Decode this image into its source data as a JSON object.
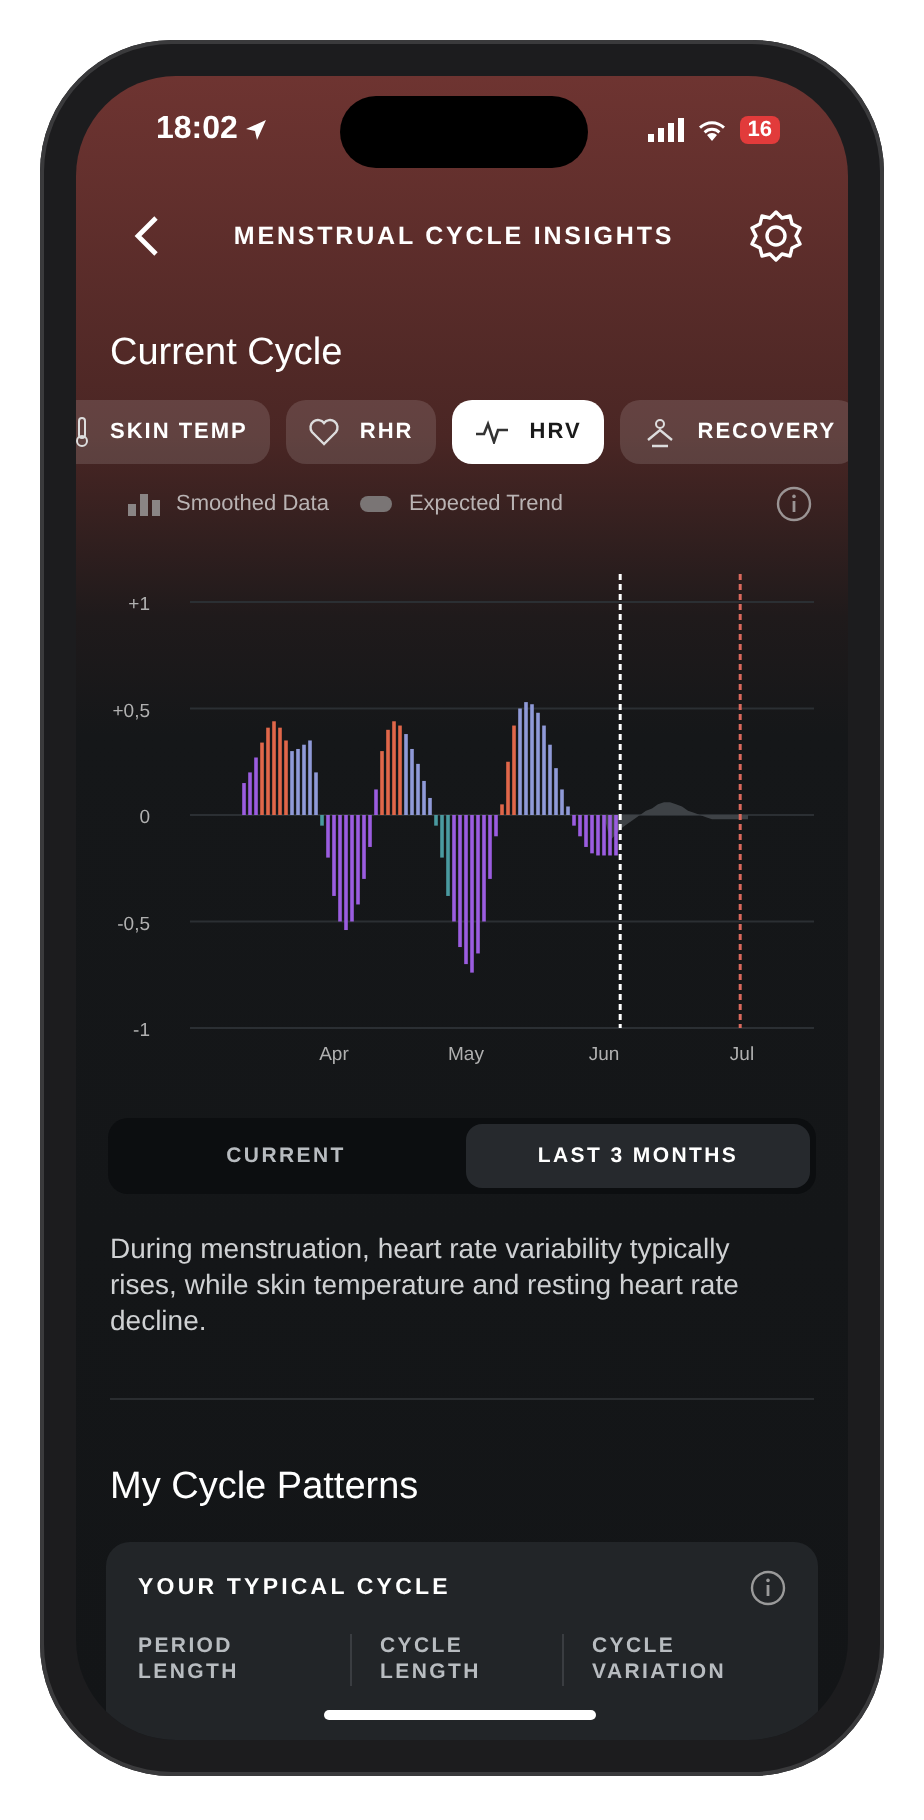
{
  "status_bar": {
    "time": "18:02",
    "battery": "16"
  },
  "header": {
    "title": "MENSTRUAL CYCLE INSIGHTS"
  },
  "current_cycle": {
    "title": "Current Cycle",
    "metric_tabs": [
      {
        "kind": "thermometer",
        "label": "SKIN TEMP",
        "selected": false
      },
      {
        "kind": "heart",
        "label": "RHR",
        "selected": false
      },
      {
        "kind": "pulse",
        "label": "HRV",
        "selected": true
      },
      {
        "kind": "recovery",
        "label": "RECOVERY",
        "selected": false
      }
    ],
    "legend": [
      {
        "kind": "bars",
        "label": "Smoothed Data"
      },
      {
        "kind": "pill",
        "label": "Expected Trend"
      }
    ],
    "chart_data": {
      "type": "bar",
      "grid": true,
      "categories": [
        null,
        null,
        null,
        null,
        null,
        null,
        null,
        null,
        null,
        null,
        null,
        null,
        null,
        null,
        null,
        "Apr",
        null,
        null,
        null,
        null,
        null,
        null,
        null,
        null,
        null,
        null,
        null,
        null,
        null,
        null,
        null,
        null,
        null,
        null,
        null,
        null,
        null,
        "May",
        null,
        null,
        null,
        null,
        null,
        null,
        null,
        null,
        null,
        null,
        null,
        null,
        null,
        null,
        null,
        null,
        null,
        null,
        null,
        null,
        null,
        null,
        "Jun",
        null,
        null,
        null,
        null,
        null,
        null,
        null,
        null,
        null,
        null,
        null,
        null,
        null,
        null,
        null,
        null,
        null,
        null,
        null,
        null,
        null,
        null,
        "Jul",
        null,
        null,
        null
      ],
      "series": [
        {
          "color": "#9b5de0",
          "values": [
            0.15,
            0.2,
            0.27,
            null,
            null,
            null,
            null,
            null,
            null,
            null,
            null,
            null,
            null,
            null,
            -0.2,
            -0.38,
            -0.5,
            -0.54,
            -0.5,
            -0.42,
            -0.3,
            -0.15,
            0.12,
            null,
            null,
            null,
            null,
            null,
            null,
            null,
            null,
            null,
            null,
            null,
            null,
            -0.5,
            -0.62,
            -0.7,
            -0.74,
            -0.65,
            -0.5,
            -0.3,
            -0.1,
            null,
            null,
            null,
            null,
            null,
            null,
            null,
            null,
            null,
            null,
            null,
            null,
            -0.05,
            -0.1,
            -0.15,
            -0.18,
            -0.19,
            -0.19,
            -0.19,
            -0.19,
            null,
            null,
            null,
            null,
            null,
            null,
            null,
            null,
            null,
            null,
            null,
            null,
            null,
            null,
            null,
            null,
            null,
            null,
            null,
            null,
            null,
            null,
            null,
            null
          ]
        },
        {
          "color": "#e0674a",
          "values": [
            null,
            null,
            null,
            0.34,
            0.41,
            0.44,
            0.41,
            0.35,
            null,
            null,
            null,
            null,
            null,
            null,
            null,
            null,
            null,
            null,
            null,
            null,
            null,
            null,
            null,
            0.3,
            0.4,
            0.44,
            0.42,
            null,
            null,
            null,
            null,
            null,
            null,
            null,
            null,
            null,
            null,
            null,
            null,
            null,
            null,
            null,
            null,
            0.05,
            0.25,
            0.42,
            null,
            null,
            null,
            null,
            null,
            null,
            null,
            null,
            null,
            null,
            null,
            null,
            null,
            null,
            null,
            null,
            null,
            null,
            null,
            null,
            null,
            null,
            null,
            null,
            null,
            null,
            null,
            null,
            null,
            null,
            null,
            null,
            null,
            null,
            null,
            null,
            null,
            null,
            null,
            null,
            null
          ]
        },
        {
          "color": "#8f9ad8",
          "values": [
            null,
            null,
            null,
            null,
            null,
            null,
            null,
            null,
            0.3,
            0.31,
            0.33,
            0.35,
            0.2,
            null,
            null,
            null,
            null,
            null,
            null,
            null,
            null,
            null,
            null,
            null,
            null,
            null,
            null,
            0.38,
            0.31,
            0.24,
            0.16,
            0.08,
            null,
            null,
            null,
            null,
            null,
            null,
            null,
            null,
            null,
            null,
            null,
            null,
            null,
            null,
            0.5,
            0.53,
            0.52,
            0.48,
            0.42,
            0.33,
            0.22,
            0.12,
            0.04,
            null,
            null,
            null,
            null,
            null,
            null,
            null,
            null,
            null,
            null,
            null,
            null,
            null,
            null,
            null,
            null,
            null,
            null,
            null,
            null,
            null,
            null,
            null,
            null,
            null,
            null,
            null,
            null,
            null,
            null,
            null,
            null
          ]
        },
        {
          "color": "#4a9aa0",
          "values": [
            null,
            null,
            null,
            null,
            null,
            null,
            null,
            null,
            null,
            null,
            null,
            null,
            null,
            -0.05,
            null,
            null,
            null,
            null,
            null,
            null,
            null,
            null,
            null,
            null,
            null,
            null,
            null,
            null,
            null,
            null,
            null,
            null,
            -0.05,
            -0.2,
            -0.38,
            null,
            null,
            null,
            null,
            null,
            null,
            null,
            null,
            null,
            null,
            null,
            null,
            null,
            null,
            null,
            null,
            null,
            null,
            null,
            null,
            null,
            null,
            null,
            null,
            null,
            null,
            null,
            null,
            null,
            null,
            null,
            null,
            null,
            null,
            null,
            null,
            null,
            null,
            null,
            null,
            null,
            null,
            null,
            null,
            null,
            null,
            null,
            null,
            null,
            null,
            null,
            null
          ]
        },
        {
          "type": "area",
          "color": "#3e4246",
          "values": [
            null,
            null,
            null,
            null,
            null,
            null,
            null,
            null,
            null,
            null,
            null,
            null,
            null,
            null,
            null,
            null,
            null,
            null,
            null,
            null,
            null,
            null,
            null,
            null,
            null,
            null,
            null,
            null,
            null,
            null,
            null,
            null,
            null,
            null,
            null,
            null,
            null,
            null,
            null,
            null,
            null,
            null,
            null,
            null,
            null,
            null,
            null,
            null,
            null,
            null,
            null,
            null,
            null,
            null,
            null,
            null,
            null,
            null,
            null,
            null,
            0,
            -0.12,
            -0.09,
            -0.06,
            -0.04,
            -0.02,
            0,
            0.02,
            0.03,
            0.05,
            0.06,
            0.06,
            0.05,
            0.04,
            0.02,
            0.01,
            0,
            -0.01,
            -0.02,
            -0.02,
            -0.02,
            -0.02,
            -0.02,
            -0.02,
            -0.02,
            null,
            null
          ]
        }
      ],
      "ylim": [
        -1,
        1
      ],
      "yticks": [
        {
          "value": 1,
          "label": "+1"
        },
        {
          "value": 0.5,
          "label": "+0,5"
        },
        {
          "value": 0,
          "label": "0"
        },
        {
          "value": -0.5,
          "label": "-0,5"
        },
        {
          "value": -1,
          "label": "-1"
        }
      ]
    },
    "range_toggle": [
      {
        "label": "CURRENT",
        "selected": false
      },
      {
        "label": "LAST 3 MONTHS",
        "selected": true
      }
    ],
    "description": "During menstruation, heart rate variability typically rises, while skin temperature and resting heart rate decline."
  },
  "patterns": {
    "title": "My Cycle Patterns",
    "card": {
      "title": "YOUR TYPICAL CYCLE",
      "columns": [
        "PERIOD LENGTH",
        "CYCLE LENGTH",
        "CYCLE VARIATION"
      ]
    }
  }
}
